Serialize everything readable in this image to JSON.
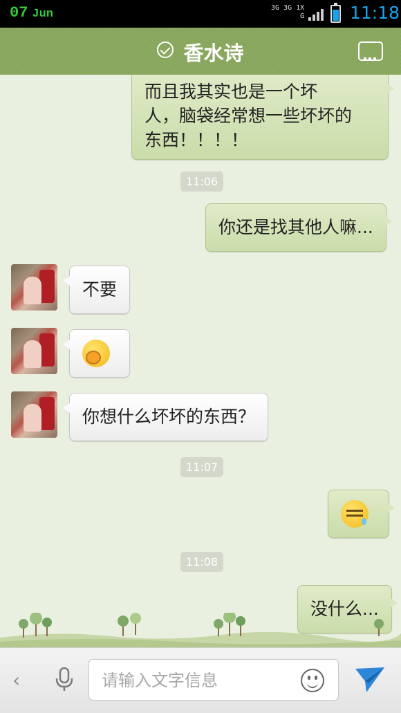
{
  "status_bar": {
    "day": "07",
    "month": "Jun",
    "network_top": "3G 3G 1X",
    "network_sub": "G",
    "time": "11:18"
  },
  "header": {
    "title": "香水诗",
    "menu_icon": "more-dots-icon"
  },
  "messages": [
    {
      "type": "text",
      "direction": "out",
      "lines": [
        "而且我其实也是一个坏",
        "人，脑袋经常想一些坏坏的",
        "东西！！！！"
      ]
    },
    {
      "type": "time",
      "text": "11:06"
    },
    {
      "type": "text",
      "direction": "out",
      "lines": [
        "你还是找其他人嘛..."
      ]
    },
    {
      "type": "text",
      "direction": "in",
      "lines": [
        "不要"
      ]
    },
    {
      "type": "emoji",
      "direction": "in",
      "icon": "yawn-emoji-icon"
    },
    {
      "type": "text",
      "direction": "in",
      "lines": [
        "你想什么坏坏的东西？"
      ]
    },
    {
      "type": "time",
      "text": "11:07"
    },
    {
      "type": "emoji",
      "direction": "out",
      "icon": "annoyed-sweat-emoji-icon"
    },
    {
      "type": "time",
      "text": "11:08"
    },
    {
      "type": "text",
      "direction": "out",
      "lines": [
        "没什么..."
      ]
    }
  ],
  "input_bar": {
    "back_glyph": "‹",
    "placeholder": "请输入文字信息",
    "value": ""
  },
  "colors": {
    "header_green": "#8aa860",
    "chat_bg": "#eaf0e0",
    "out_bubble": "#d4e3b6",
    "in_bubble": "#f7f7f7",
    "time_accent": "#1aa4e8",
    "date_accent": "#37c83a"
  }
}
